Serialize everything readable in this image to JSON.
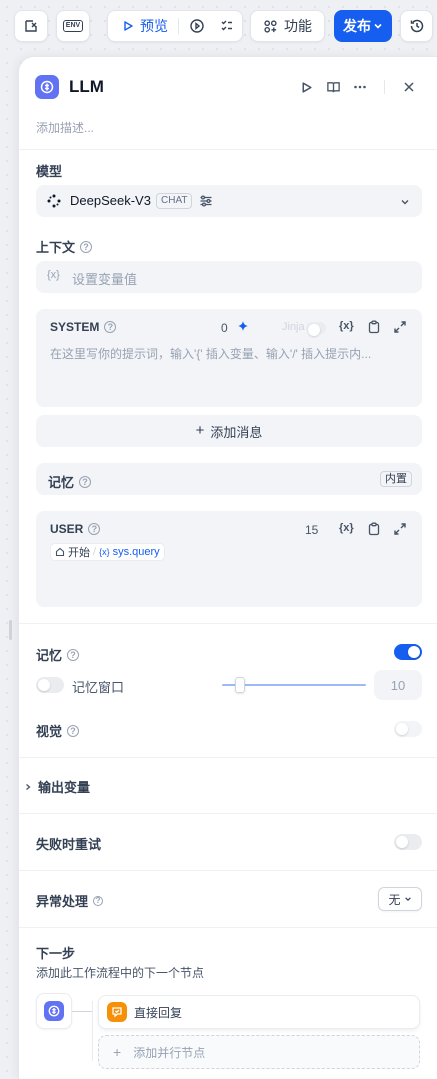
{
  "toolbar": {
    "env_label": "ENV",
    "preview_label": "预览",
    "features_label": "功能",
    "publish_label": "发布"
  },
  "node": {
    "title": "LLM",
    "description_placeholder": "添加描述..."
  },
  "model": {
    "section_label": "模型",
    "name": "DeepSeek-V3",
    "mode_tag": "CHAT"
  },
  "context": {
    "section_label": "上下文",
    "placeholder": "设置变量值",
    "var_glyph": "{x}"
  },
  "system_prompt": {
    "role": "SYSTEM",
    "char_count": "0",
    "jinja_label": "Jinja",
    "placeholder": "在这里写你的提示词，输入'{' 插入变量、输入'/' 插入提示内..."
  },
  "add_message_label": "添加消息",
  "memory_row": {
    "label": "记忆",
    "badge": "内置"
  },
  "user_prompt": {
    "role": "USER",
    "char_count": "15",
    "var_source": "开始",
    "var_name": "sys.query"
  },
  "memory": {
    "label": "记忆",
    "enabled": true,
    "window_label": "记忆窗口",
    "window_enabled": false,
    "window_value": "10",
    "slider_fraction": 0.1
  },
  "vision": {
    "label": "视觉",
    "enabled": false
  },
  "output_vars_label": "输出变量",
  "retry": {
    "label": "失败时重试",
    "enabled": false
  },
  "error_handling": {
    "label": "异常处理",
    "value": "无"
  },
  "next_step": {
    "title": "下一步",
    "subtitle": "添加此工作流程中的下一个节点",
    "next_node_label": "直接回复",
    "add_parallel_label": "添加并行节点"
  },
  "colors": {
    "accent": "#155eef",
    "llm_icon": "#6172f3",
    "answer_icon": "#f79009"
  }
}
